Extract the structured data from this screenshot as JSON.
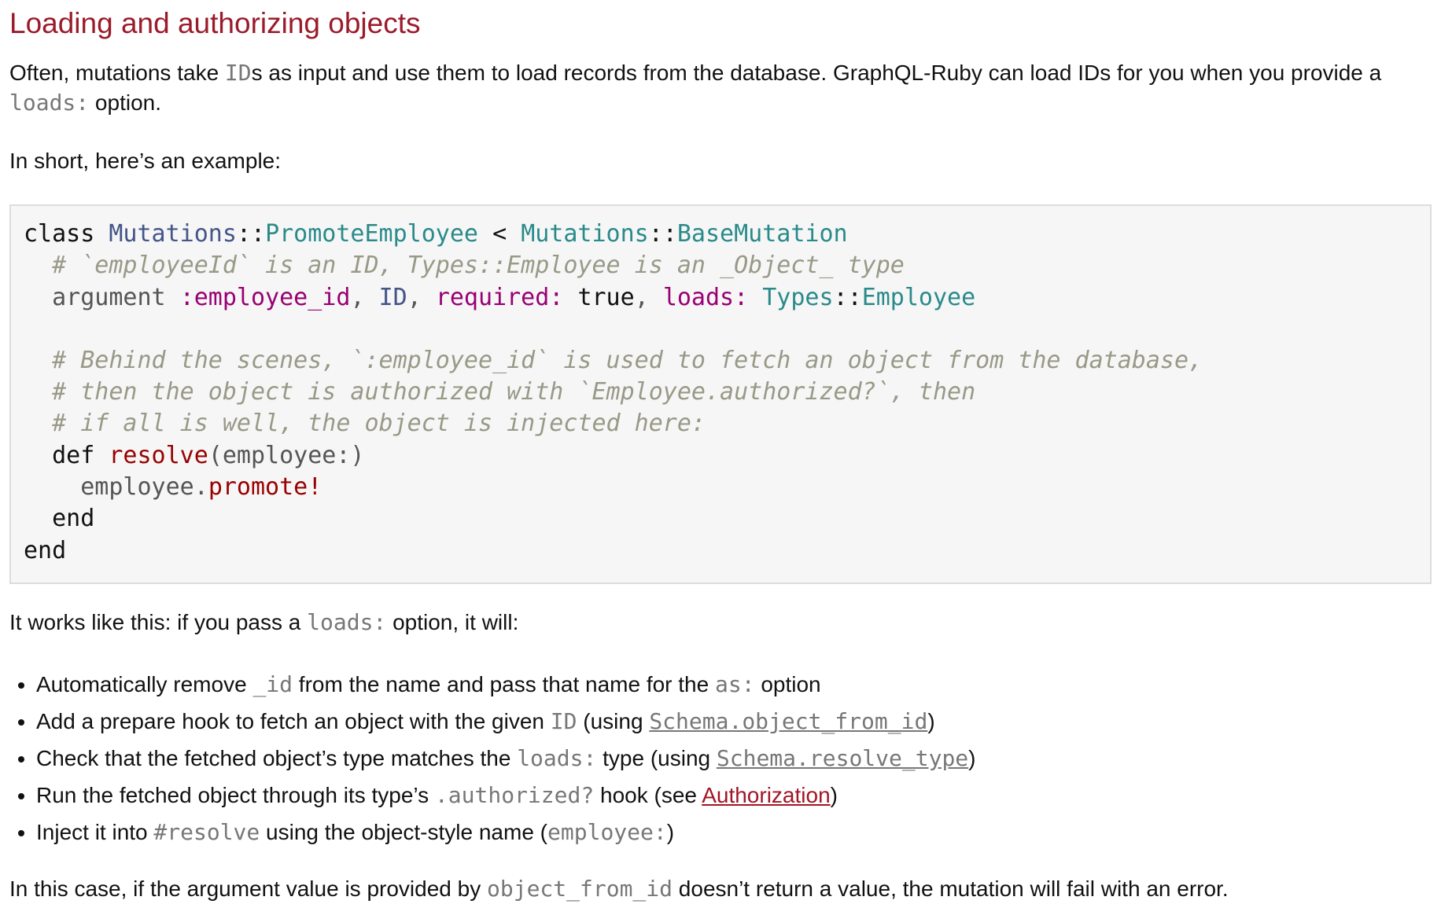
{
  "heading": "Loading and authorizing objects",
  "intro": {
    "t1": "Often, mutations take ",
    "c1": "ID",
    "t2": "s as input and use them to load records from the database. GraphQL-Ruby can load IDs for you when you provide a ",
    "c2": "loads:",
    "t3": " option."
  },
  "example_intro": "In short, here’s an example:",
  "code": {
    "l1": {
      "k1": "class",
      "s1": " ",
      "c1": "Mutations",
      "o1": "::",
      "c2": "PromoteEmployee",
      "s2": " ",
      "o2": "<",
      "s3": " ",
      "c3": "Mutations",
      "o3": "::",
      "c4": "BaseMutation"
    },
    "l2": {
      "ind": "  ",
      "cm": "# `employeeId` is an ID, Types::Employee is an _Object_ type"
    },
    "l3": {
      "ind": "  ",
      "p1": "argument ",
      "s1": ":employee_id",
      "p2": ", ",
      "c1": "ID",
      "p3": ", ",
      "s2": "required:",
      "p4": " ",
      "k1": "true",
      "p5": ", ",
      "s3": "loads:",
      "p6": " ",
      "c2": "Types",
      "o1": "::",
      "c3": "Employee"
    },
    "l4": "",
    "l5": {
      "ind": "  ",
      "cm": "# Behind the scenes, `:employee_id` is used to fetch an object from the database,"
    },
    "l6": {
      "ind": "  ",
      "cm": "# then the object is authorized with `Employee.authorized?`, then"
    },
    "l7": {
      "ind": "  ",
      "cm": "# if all is well, the object is injected here:"
    },
    "l8": {
      "ind": "  ",
      "k1": "def",
      "s1": " ",
      "f1": "resolve",
      "p1": "(employee:)"
    },
    "l9": {
      "ind": "    ",
      "p1": "employee.",
      "f1": "promote!"
    },
    "l10": {
      "ind": "  ",
      "k1": "end"
    },
    "l11": {
      "k1": "end"
    }
  },
  "works_intro": {
    "t1": "It works like this: if you pass a ",
    "c1": "loads:",
    "t2": " option, it will:"
  },
  "steps": [
    {
      "t1": "Automatically remove ",
      "c1": "_id",
      "t2": " from the name and pass that name for the ",
      "c2": "as:",
      "t3": " option"
    },
    {
      "t1": "Add a prepare hook to fetch an object with the given ",
      "c1": "ID",
      "t2": " (using ",
      "link": "Schema.object_from_id",
      "t3": ")"
    },
    {
      "t1": "Check that the fetched object’s type matches the ",
      "c1": "loads:",
      "t2": " type (using ",
      "link": "Schema.resolve_type",
      "t3": ")"
    },
    {
      "t1": "Run the fetched object through its type’s ",
      "c1": ".authorized?",
      "t2": " hook (see ",
      "link": "Authorization",
      "t3": ")"
    },
    {
      "t1": "Inject it into ",
      "c1": "#resolve",
      "t2": " using the object-style name (",
      "c2": "employee:",
      "t3": ")"
    }
  ],
  "conclusion": {
    "t1": "In this case, if the argument value is provided by ",
    "c1": "object_from_id",
    "t2": " doesn’t return a value, the mutation will fail with an error."
  }
}
